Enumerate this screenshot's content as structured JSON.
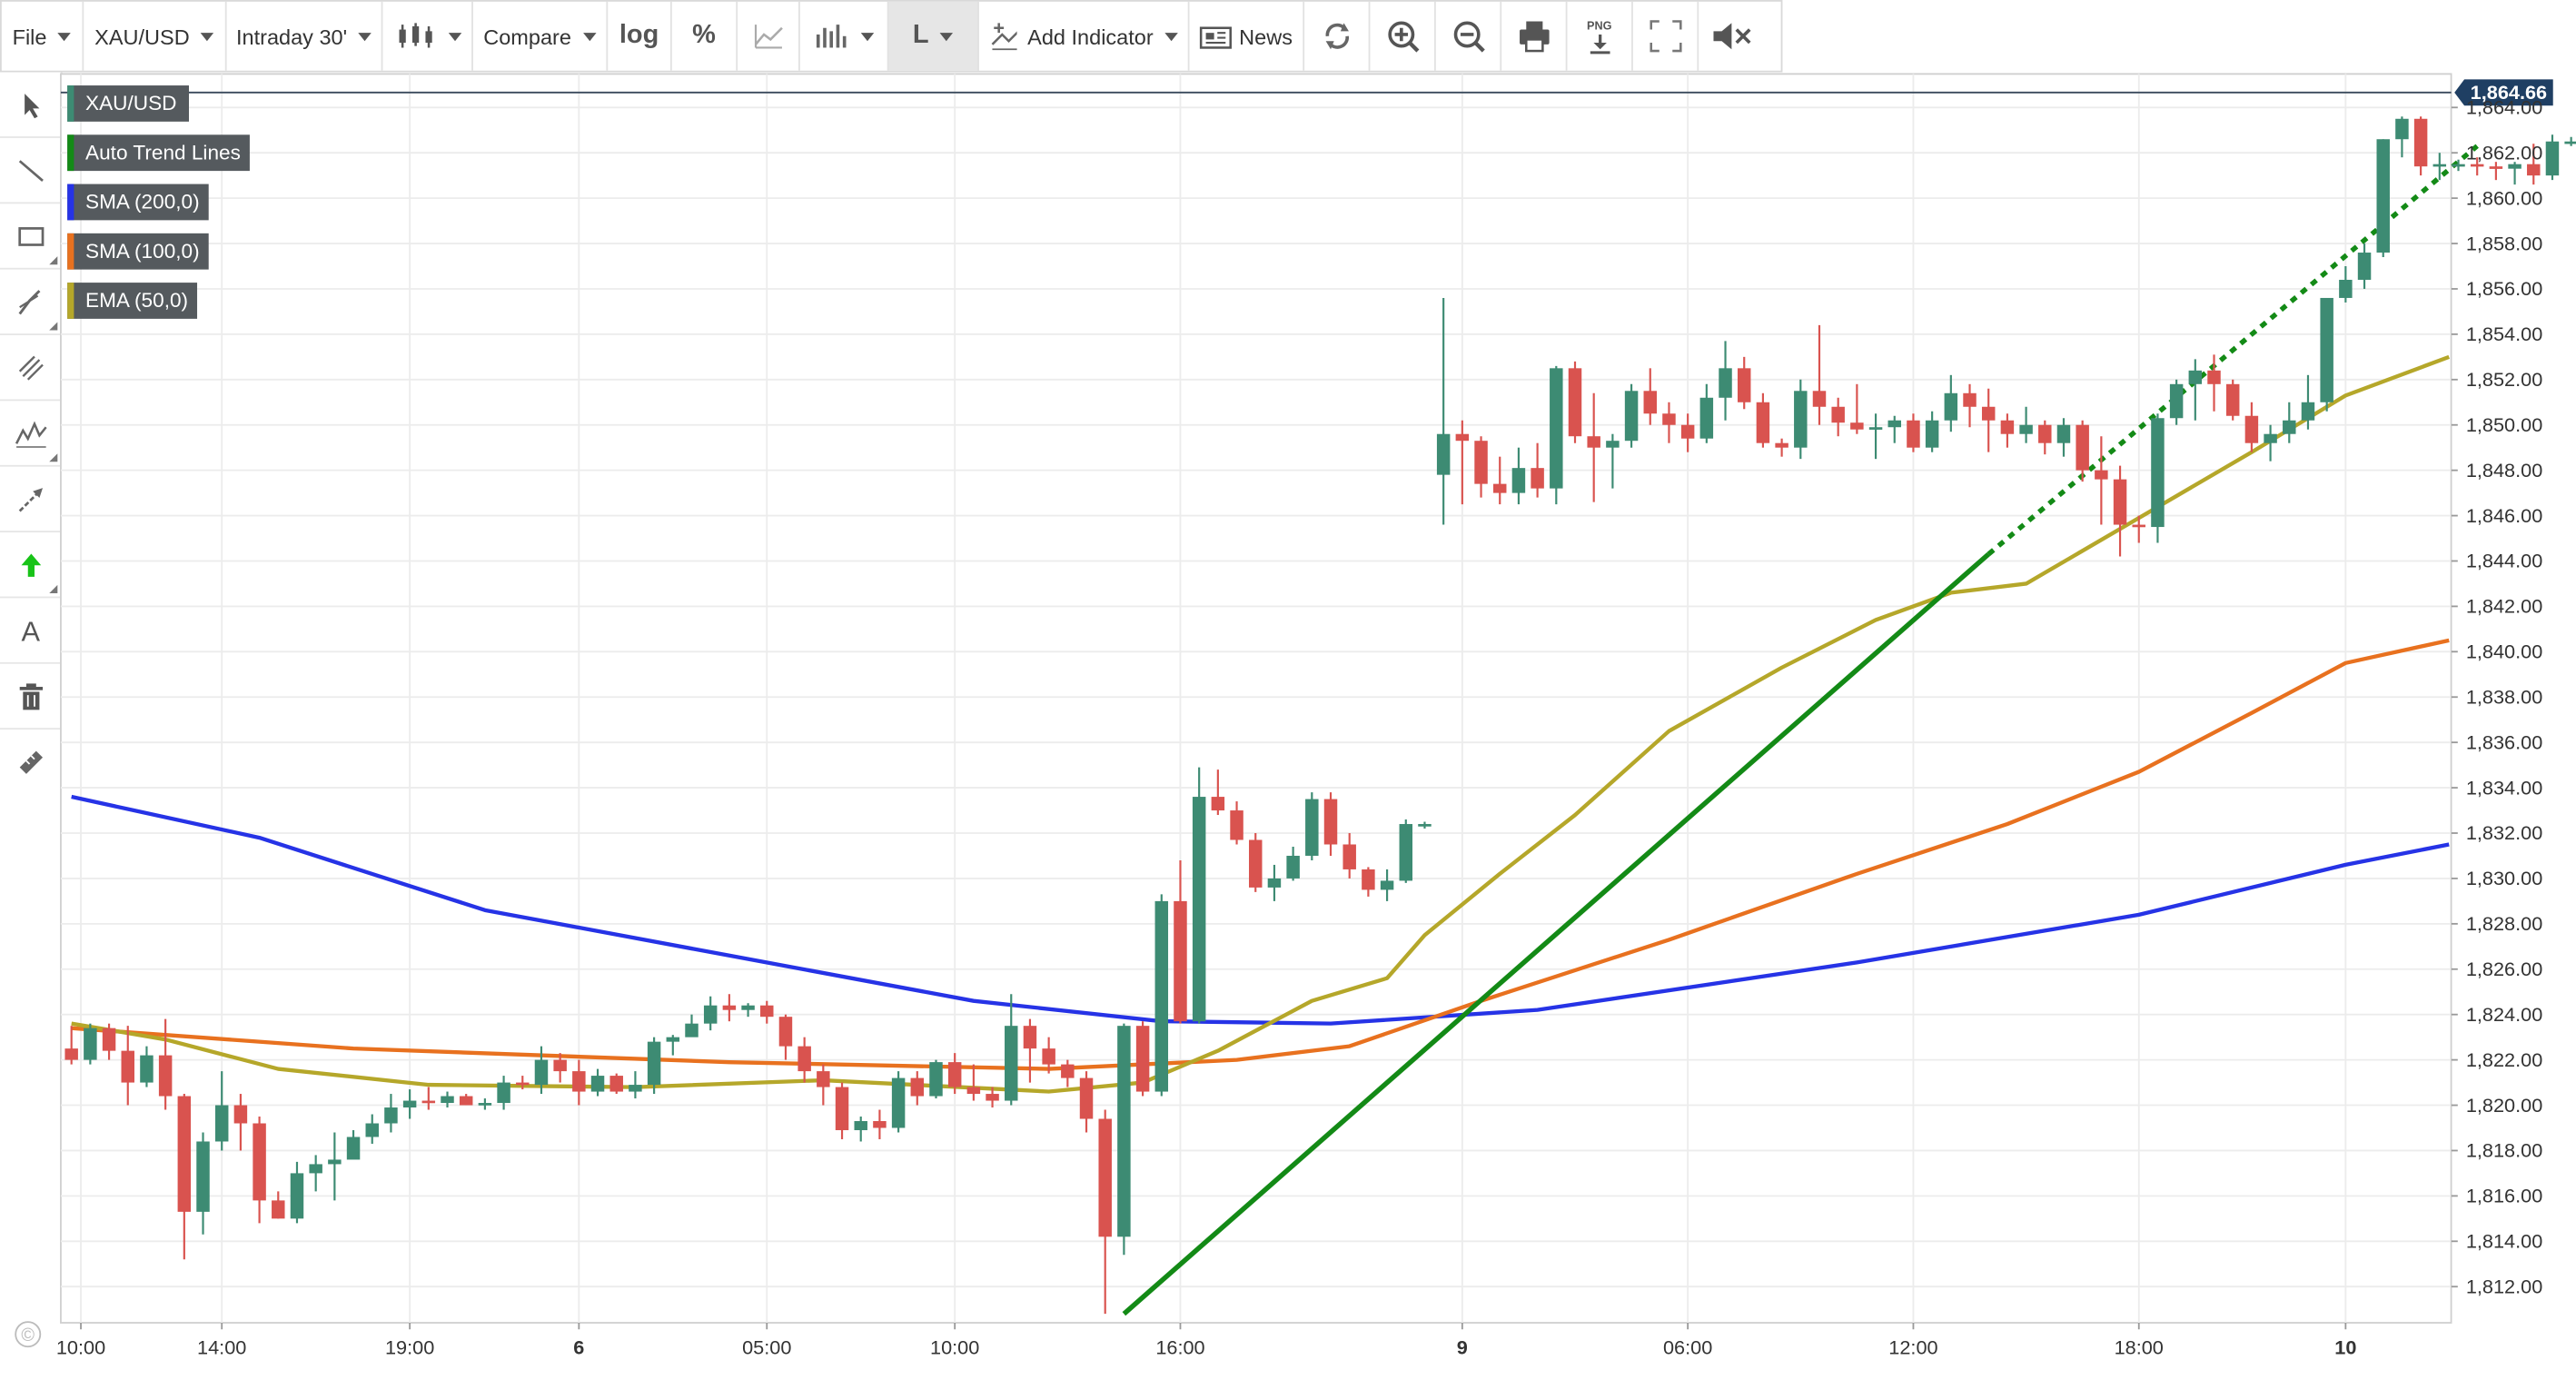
{
  "toolbar": {
    "file": "File",
    "symbol": "XAU/USD",
    "interval": "Intraday 30'",
    "compare": "Compare",
    "log": "log",
    "percent": "%",
    "line_mode": "L",
    "add_indicator": "Add Indicator",
    "news": "News",
    "png": "PNG"
  },
  "copyright_symbol": "©",
  "colors": {
    "up": "#3d8b73",
    "down": "#d9534f",
    "trend": "#138a16",
    "sma200": "#2633e6",
    "sma100": "#e8711f",
    "ema50": "#b5a72a",
    "last_price_bg": "#1f3f63",
    "legend_bg": "#555a5e"
  },
  "chart_data": {
    "type": "candlestick",
    "legend": [
      {
        "label": "XAU/USD",
        "color": "#3d8b73"
      },
      {
        "label": "Auto Trend Lines",
        "color": "#138a16"
      },
      {
        "label": "SMA (200,0)",
        "color": "#2633e6"
      },
      {
        "label": "SMA (100,0)",
        "color": "#e8711f"
      },
      {
        "label": "EMA (50,0)",
        "color": "#b5a72a"
      }
    ],
    "last_price": "1,864.66",
    "last_price_value": 1864.66,
    "ylim": [
      1810.8,
      1866.1
    ],
    "y_ticks": [
      "1,812.00",
      "1,814.00",
      "1,816.00",
      "1,818.00",
      "1,820.00",
      "1,822.00",
      "1,824.00",
      "1,826.00",
      "1,828.00",
      "1,830.00",
      "1,832.00",
      "1,834.00",
      "1,836.00",
      "1,838.00",
      "1,840.00",
      "1,842.00",
      "1,844.00",
      "1,846.00",
      "1,848.00",
      "1,850.00",
      "1,852.00",
      "1,854.00",
      "1,856.00",
      "1,858.00",
      "1,860.00",
      "1,862.00",
      "1,864.00"
    ],
    "x_ticks": [
      {
        "label": "10:00",
        "bar": 0.5,
        "bold": false
      },
      {
        "label": "14:00",
        "bar": 8,
        "bold": false
      },
      {
        "label": "19:00",
        "bar": 18,
        "bold": false
      },
      {
        "label": "6",
        "bar": 27,
        "bold": true
      },
      {
        "label": "05:00",
        "bar": 37,
        "bold": false
      },
      {
        "label": "10:00",
        "bar": 47,
        "bold": false
      },
      {
        "label": "16:00",
        "bar": 59,
        "bold": false
      },
      {
        "label": "9",
        "bar": 74,
        "bold": true
      },
      {
        "label": "06:00",
        "bar": 86,
        "bold": false
      },
      {
        "label": "12:00",
        "bar": 98,
        "bold": false
      },
      {
        "label": "18:00",
        "bar": 110,
        "bold": false
      },
      {
        "label": "10",
        "bar": 121,
        "bold": true
      }
    ],
    "candles": [
      [
        1822.5,
        1823.5,
        1821.8,
        1822.0
      ],
      [
        1822.0,
        1823.6,
        1821.8,
        1823.4
      ],
      [
        1823.4,
        1823.6,
        1822.0,
        1822.4
      ],
      [
        1822.4,
        1823.5,
        1820.0,
        1821.0
      ],
      [
        1821.0,
        1822.6,
        1820.8,
        1822.2
      ],
      [
        1822.2,
        1823.8,
        1819.8,
        1820.4
      ],
      [
        1820.4,
        1820.5,
        1813.2,
        1815.3
      ],
      [
        1815.3,
        1818.8,
        1814.3,
        1818.4
      ],
      [
        1818.4,
        1821.5,
        1818.0,
        1820.0
      ],
      [
        1820.0,
        1820.5,
        1818.0,
        1819.2
      ],
      [
        1819.2,
        1819.5,
        1814.8,
        1815.8
      ],
      [
        1815.8,
        1816.2,
        1815.0,
        1815.0
      ],
      [
        1815.0,
        1817.5,
        1814.8,
        1817.0
      ],
      [
        1817.0,
        1817.8,
        1816.2,
        1817.4
      ],
      [
        1817.4,
        1818.8,
        1815.8,
        1817.6
      ],
      [
        1817.6,
        1818.9,
        1818.0,
        1818.6
      ],
      [
        1818.6,
        1819.6,
        1818.3,
        1819.2
      ],
      [
        1819.2,
        1820.5,
        1818.8,
        1819.9
      ],
      [
        1819.9,
        1820.7,
        1819.4,
        1820.2
      ],
      [
        1820.2,
        1820.8,
        1819.8,
        1820.1
      ],
      [
        1820.1,
        1820.6,
        1819.9,
        1820.4
      ],
      [
        1820.4,
        1820.5,
        1820.0,
        1820.0
      ],
      [
        1820.0,
        1820.3,
        1819.8,
        1820.1
      ],
      [
        1820.1,
        1821.3,
        1819.8,
        1821.0
      ],
      [
        1821.0,
        1821.3,
        1820.7,
        1820.9
      ],
      [
        1820.9,
        1822.6,
        1820.5,
        1822.0
      ],
      [
        1822.0,
        1822.3,
        1821.0,
        1821.5
      ],
      [
        1821.5,
        1822.0,
        1820.0,
        1820.6
      ],
      [
        1820.6,
        1821.6,
        1820.4,
        1821.3
      ],
      [
        1821.3,
        1821.4,
        1820.5,
        1820.6
      ],
      [
        1820.6,
        1821.5,
        1820.3,
        1820.9
      ],
      [
        1820.9,
        1823.0,
        1820.5,
        1822.8
      ],
      [
        1822.8,
        1823.1,
        1822.2,
        1823.0
      ],
      [
        1823.0,
        1824.0,
        1823.2,
        1823.6
      ],
      [
        1823.6,
        1824.8,
        1823.3,
        1824.4
      ],
      [
        1824.4,
        1824.9,
        1823.7,
        1824.2
      ],
      [
        1824.2,
        1824.5,
        1823.9,
        1824.4
      ],
      [
        1824.4,
        1824.6,
        1823.6,
        1823.9
      ],
      [
        1823.9,
        1824.0,
        1822.0,
        1822.6
      ],
      [
        1822.6,
        1823.0,
        1821.0,
        1821.5
      ],
      [
        1821.5,
        1821.8,
        1820.0,
        1820.8
      ],
      [
        1820.8,
        1821.0,
        1818.5,
        1818.9
      ],
      [
        1818.9,
        1819.5,
        1818.4,
        1819.3
      ],
      [
        1819.3,
        1819.8,
        1818.5,
        1819.0
      ],
      [
        1819.0,
        1821.5,
        1818.8,
        1821.2
      ],
      [
        1821.2,
        1821.5,
        1820.0,
        1820.4
      ],
      [
        1820.4,
        1822.0,
        1820.3,
        1821.9
      ],
      [
        1821.9,
        1822.3,
        1820.5,
        1820.8
      ],
      [
        1820.8,
        1821.8,
        1820.2,
        1820.5
      ],
      [
        1820.5,
        1820.8,
        1819.9,
        1820.2
      ],
      [
        1820.2,
        1824.9,
        1820.0,
        1823.5
      ],
      [
        1823.5,
        1823.8,
        1821.0,
        1822.5
      ],
      [
        1822.5,
        1823.0,
        1821.4,
        1821.8
      ],
      [
        1821.8,
        1822.0,
        1820.8,
        1821.2
      ],
      [
        1821.2,
        1821.5,
        1818.8,
        1819.4
      ],
      [
        1819.4,
        1819.8,
        1810.8,
        1814.2
      ],
      [
        1814.2,
        1823.6,
        1813.4,
        1823.5
      ],
      [
        1823.5,
        1823.7,
        1820.4,
        1820.6
      ],
      [
        1820.6,
        1829.3,
        1820.4,
        1829.0
      ],
      [
        1829.0,
        1830.8,
        1823.6,
        1823.7
      ],
      [
        1823.7,
        1834.9,
        1823.6,
        1833.6
      ],
      [
        1833.6,
        1834.8,
        1832.8,
        1833.0
      ],
      [
        1833.0,
        1833.4,
        1831.5,
        1831.7
      ],
      [
        1831.7,
        1832.0,
        1829.4,
        1829.6
      ],
      [
        1829.6,
        1830.6,
        1829.0,
        1830.0
      ],
      [
        1830.0,
        1831.4,
        1829.9,
        1831.0
      ],
      [
        1831.0,
        1833.8,
        1830.8,
        1833.5
      ],
      [
        1833.5,
        1833.8,
        1831.0,
        1831.5
      ],
      [
        1831.5,
        1832.0,
        1830.0,
        1830.4
      ],
      [
        1830.4,
        1830.5,
        1829.2,
        1829.5
      ],
      [
        1829.5,
        1830.4,
        1829.0,
        1829.9
      ],
      [
        1829.9,
        1832.6,
        1829.8,
        1832.4
      ],
      [
        1832.4,
        1832.5,
        1832.2,
        1832.4
      ],
      [
        1847.8,
        1855.6,
        1845.6,
        1849.6
      ],
      [
        1849.6,
        1850.2,
        1846.5,
        1849.3
      ],
      [
        1849.3,
        1849.5,
        1846.8,
        1847.4
      ],
      [
        1847.4,
        1848.6,
        1846.5,
        1847.0
      ],
      [
        1847.0,
        1849.0,
        1846.5,
        1848.1
      ],
      [
        1848.1,
        1849.2,
        1846.8,
        1847.2
      ],
      [
        1847.2,
        1852.6,
        1846.5,
        1852.5
      ],
      [
        1852.5,
        1852.8,
        1849.2,
        1849.5
      ],
      [
        1849.5,
        1851.4,
        1846.6,
        1849.0
      ],
      [
        1849.0,
        1849.6,
        1847.2,
        1849.3
      ],
      [
        1849.3,
        1851.8,
        1849.0,
        1851.5
      ],
      [
        1851.5,
        1852.5,
        1850.0,
        1850.5
      ],
      [
        1850.5,
        1851.0,
        1849.2,
        1850.0
      ],
      [
        1850.0,
        1850.5,
        1848.8,
        1849.4
      ],
      [
        1849.4,
        1851.8,
        1849.2,
        1851.2
      ],
      [
        1851.2,
        1853.7,
        1850.2,
        1852.5
      ],
      [
        1852.5,
        1853.0,
        1850.7,
        1851.0
      ],
      [
        1851.0,
        1851.4,
        1849.0,
        1849.2
      ],
      [
        1849.2,
        1849.4,
        1848.6,
        1849.0
      ],
      [
        1849.0,
        1852.0,
        1848.5,
        1851.5
      ],
      [
        1851.5,
        1854.4,
        1850.0,
        1850.8
      ],
      [
        1850.8,
        1851.2,
        1849.5,
        1850.1
      ],
      [
        1850.1,
        1851.8,
        1849.6,
        1849.8
      ],
      [
        1849.8,
        1850.5,
        1848.5,
        1849.9
      ],
      [
        1849.9,
        1850.4,
        1849.2,
        1850.2
      ],
      [
        1850.2,
        1850.5,
        1848.8,
        1849.0
      ],
      [
        1849.0,
        1850.6,
        1848.8,
        1850.2
      ],
      [
        1850.2,
        1852.2,
        1849.7,
        1851.4
      ],
      [
        1851.4,
        1851.8,
        1849.9,
        1850.8
      ],
      [
        1850.8,
        1851.6,
        1848.8,
        1850.2
      ],
      [
        1850.2,
        1850.5,
        1849.0,
        1849.6
      ],
      [
        1849.6,
        1850.8,
        1849.2,
        1850.0
      ],
      [
        1850.0,
        1850.2,
        1848.7,
        1849.2
      ],
      [
        1849.2,
        1850.3,
        1848.6,
        1850.0
      ],
      [
        1850.0,
        1850.2,
        1847.5,
        1848.0
      ],
      [
        1848.0,
        1849.5,
        1845.6,
        1847.6
      ],
      [
        1847.6,
        1848.2,
        1844.2,
        1845.6
      ],
      [
        1845.6,
        1846.0,
        1844.8,
        1845.5
      ],
      [
        1845.5,
        1850.5,
        1844.8,
        1850.3
      ],
      [
        1850.3,
        1852.0,
        1850.0,
        1851.8
      ],
      [
        1851.8,
        1852.9,
        1850.2,
        1852.4
      ],
      [
        1852.4,
        1853.1,
        1850.6,
        1851.8
      ],
      [
        1851.8,
        1852.0,
        1850.2,
        1850.4
      ],
      [
        1850.4,
        1851.0,
        1848.8,
        1849.2
      ],
      [
        1849.2,
        1850.0,
        1848.4,
        1849.6
      ],
      [
        1849.6,
        1851.0,
        1849.2,
        1850.2
      ],
      [
        1850.2,
        1852.2,
        1849.8,
        1851.0
      ],
      [
        1851.0,
        1852.8,
        1850.6,
        1855.6
      ],
      [
        1855.6,
        1857.0,
        1855.4,
        1856.4
      ],
      [
        1856.4,
        1858.0,
        1856.0,
        1857.6
      ],
      [
        1857.6,
        1862.6,
        1857.4,
        1862.6
      ],
      [
        1862.6,
        1863.6,
        1861.8,
        1863.5
      ],
      [
        1863.5,
        1863.6,
        1861.0,
        1861.4
      ],
      [
        1861.4,
        1862.0,
        1860.8,
        1861.5
      ],
      [
        1861.5,
        1861.7,
        1861.2,
        1861.5
      ],
      [
        1861.5,
        1861.8,
        1861.0,
        1861.4
      ],
      [
        1861.4,
        1861.6,
        1860.8,
        1861.3
      ],
      [
        1861.3,
        1861.6,
        1860.6,
        1861.5
      ],
      [
        1861.5,
        1862.4,
        1860.6,
        1861.0
      ],
      [
        1861.0,
        1862.8,
        1860.8,
        1862.5
      ],
      [
        1862.5,
        1862.7,
        1862.3,
        1862.5
      ],
      [
        1862.5,
        1865.6,
        1861.8,
        1863.9
      ],
      [
        1863.9,
        1865.3,
        1862.8,
        1864.6
      ],
      [
        1864.6,
        1865.4,
        1864.3,
        1864.7
      ]
    ],
    "lines": {
      "sma200": [
        [
          0,
          1833.6
        ],
        [
          10,
          1831.8
        ],
        [
          22,
          1828.6
        ],
        [
          35,
          1826.6
        ],
        [
          48,
          1824.6
        ],
        [
          58,
          1823.7
        ],
        [
          67,
          1823.6
        ],
        [
          78,
          1824.2
        ],
        [
          95,
          1826.3
        ],
        [
          110,
          1828.4
        ],
        [
          121,
          1830.6
        ],
        [
          126.5,
          1831.5
        ]
      ],
      "sma100": [
        [
          0,
          1823.4
        ],
        [
          15,
          1822.5
        ],
        [
          35,
          1821.9
        ],
        [
          52,
          1821.6
        ],
        [
          62,
          1822.0
        ],
        [
          68,
          1822.6
        ],
        [
          75,
          1824.6
        ],
        [
          85,
          1827.3
        ],
        [
          95,
          1830.2
        ],
        [
          103,
          1832.4
        ],
        [
          110,
          1834.7
        ],
        [
          116,
          1837.3
        ],
        [
          121,
          1839.5
        ],
        [
          126.5,
          1840.5
        ]
      ],
      "ema50": [
        [
          0,
          1823.6
        ],
        [
          5,
          1822.9
        ],
        [
          11,
          1821.6
        ],
        [
          19,
          1820.9
        ],
        [
          30,
          1820.8
        ],
        [
          40,
          1821.1
        ],
        [
          52,
          1820.6
        ],
        [
          57,
          1821.0
        ],
        [
          61,
          1822.4
        ],
        [
          66,
          1824.6
        ],
        [
          70,
          1825.6
        ],
        [
          72,
          1827.5
        ],
        [
          76,
          1830.2
        ],
        [
          80,
          1832.8
        ],
        [
          85,
          1836.5
        ],
        [
          91,
          1839.3
        ],
        [
          96,
          1841.4
        ],
        [
          100,
          1842.6
        ],
        [
          104,
          1843.0
        ],
        [
          110,
          1845.9
        ],
        [
          116,
          1848.8
        ],
        [
          121,
          1851.3
        ],
        [
          126.5,
          1853.0
        ]
      ]
    },
    "trend_line": {
      "solid": [
        [
          56,
          1810.8
        ],
        [
          102,
          1844.3
        ]
      ],
      "dotted": [
        [
          102,
          1844.3
        ],
        [
          128,
          1862.3
        ]
      ]
    }
  }
}
